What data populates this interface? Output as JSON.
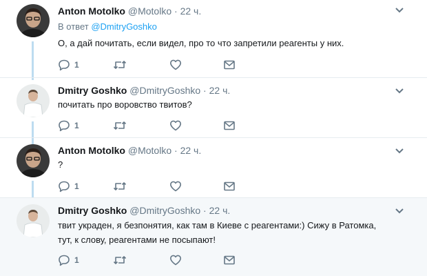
{
  "colors": {
    "accent": "#1da1f2",
    "thread_line": "#bddcf0",
    "meta": "#657786",
    "highlight_bg": "#f5f8fa"
  },
  "tweets": [
    {
      "name": "Anton Motolko",
      "handle": "@Motolko",
      "sep": "·",
      "time": "22 ч.",
      "reply_prefix": "В ответ",
      "reply_to": "@DmitryGoshko",
      "text": "О, а дай почитать, если видел, про то что запретили реагенты у них.",
      "reply_count": "1",
      "icons": [
        "reply-icon",
        "retweet-icon",
        "like-icon",
        "direct-message-icon",
        "chevron-down-icon"
      ]
    },
    {
      "name": "Dmitry Goshko",
      "handle": "@DmitryGoshko",
      "sep": "·",
      "time": "22 ч.",
      "text": "почитать про воровство твитов?",
      "reply_count": "1"
    },
    {
      "name": "Anton Motolko",
      "handle": "@Motolko",
      "sep": "·",
      "time": "22 ч.",
      "text": "?",
      "reply_count": "1"
    },
    {
      "name": "Dmitry Goshko",
      "handle": "@DmitryGoshko",
      "sep": "·",
      "time": "22 ч.",
      "text_line1": "твит украден, я безпонятия, как там в Киеве с реагентами:) Сижу в Ратомка,",
      "text_line2": "тут, к слову, реагентами не посыпают!",
      "reply_count": "1"
    }
  ]
}
